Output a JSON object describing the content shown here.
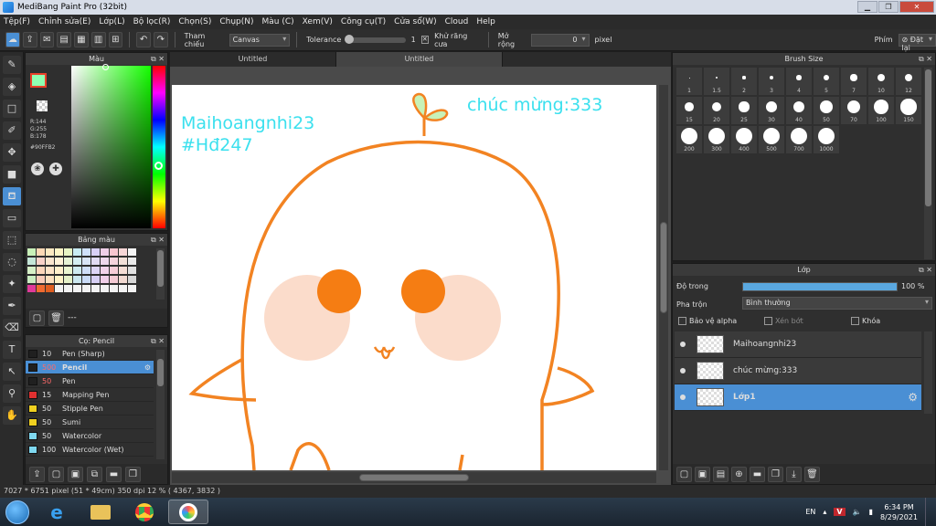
{
  "window": {
    "title": "MediBang Paint Pro (32bit)"
  },
  "menu": [
    "Tệp(F)",
    "Chỉnh sửa(E)",
    "Lớp(L)",
    "Bộ lọc(R)",
    "Chọn(S)",
    "Chụp(N)",
    "Màu (C)",
    "Xem(V)",
    "Công cụ(T)",
    "Cửa sổ(W)",
    "Cloud",
    "Help"
  ],
  "toolbar": {
    "reference_label": "Tham chiếu",
    "reference_value": "Canvas",
    "tolerance_label": "Tolerance",
    "tolerance_value": "1",
    "antialias_label": "Khử răng cưa",
    "expand_label": "Mở rộng",
    "expand_value": "0",
    "expand_unit": "pixel",
    "key_label": "Phím",
    "reset_label": "Đặt lại"
  },
  "color_panel": {
    "title": "Màu",
    "r": "R:144",
    "g": "G:255",
    "b": "B:178",
    "hex": "#90FFB2",
    "primary": "#90FFB2",
    "secondary": "#e8402a"
  },
  "palette_panel": {
    "title": "Bảng màu",
    "footer": "---",
    "colors": [
      "#c8f0b8",
      "#fdd8b5",
      "#fde9c1",
      "#fef5c6",
      "#e7f4c4",
      "#c9ecf3",
      "#cfe0fb",
      "#d8d0f6",
      "#f0cfe8",
      "#f8c6d0",
      "#f6d6d6",
      "#f4f4f4",
      "#c5e6d8",
      "#f9d2c9",
      "#fbe6cf",
      "#fff2d8",
      "#e6f2d5",
      "#d5eef2",
      "#d9e4f6",
      "#e1dbf3",
      "#efd8ec",
      "#f6d4dd",
      "#f2e0d8",
      "#eaeaea",
      "#d6f0c7",
      "#fcd6bb",
      "#fde4c8",
      "#fff0cc",
      "#eaf5d0",
      "#cfeaf0",
      "#d0def8",
      "#ddd5f6",
      "#f3d3ea",
      "#f7cdd8",
      "#f4ddd5",
      "#e0e0e0",
      "#c9ecc0",
      "#f8ccb9",
      "#fce0bf",
      "#fff3c7",
      "#e5f1c8",
      "#cbe7ef",
      "#cadbf7",
      "#d7cff4",
      "#f1cfe9",
      "#f4cad4",
      "#f1d9d1",
      "#d6d6d6",
      "#e03a9a",
      "#f06b30",
      "#e05e20",
      "#f3f3f3",
      "#f3f3f3",
      "#f3f3f3",
      "#f3f3f3",
      "#f3f3f3",
      "#f3f3f3",
      "#f3f3f3",
      "#f3f3f3",
      "#f3f3f3"
    ]
  },
  "brush_panel": {
    "title": "Cọ: Pencil",
    "brushes": [
      {
        "size": "10",
        "name": "Pen (Sharp)",
        "color": "#202020"
      },
      {
        "size": "500",
        "name": "Pencil",
        "color": "#202020",
        "selected": true
      },
      {
        "size": "50",
        "name": "Pen",
        "color": "#202020"
      },
      {
        "size": "15",
        "name": "Mapping Pen",
        "color": "#e03030"
      },
      {
        "size": "50",
        "name": "Stipple Pen",
        "color": "#f0d020"
      },
      {
        "size": "50",
        "name": "Sumi",
        "color": "#f0d020"
      },
      {
        "size": "50",
        "name": "Watercolor",
        "color": "#7fd8f0"
      },
      {
        "size": "100",
        "name": "Watercolor (Wet)",
        "color": "#7fd8f0"
      }
    ]
  },
  "canvas": {
    "tabs": [
      "Untitled",
      "Untitled"
    ],
    "text1": "Maihoangnhi23",
    "text2": "#Hđ247",
    "text3": "chúc mừng:333"
  },
  "brush_size_panel": {
    "title": "Brush Size",
    "sizes": [
      "1",
      "1.5",
      "2",
      "3",
      "4",
      "5",
      "7",
      "10",
      "12",
      "15",
      "20",
      "25",
      "30",
      "40",
      "50",
      "70",
      "100",
      "150",
      "200",
      "300",
      "400",
      "500",
      "700",
      "1000"
    ]
  },
  "layer_panel": {
    "title": "Lớp",
    "opacity_label": "Độ trong",
    "opacity_value": "100 %",
    "opacity_fraction": 1.0,
    "blend_label": "Pha trộn",
    "blend_value": "Bình thường",
    "protect_alpha": "Bảo vệ alpha",
    "clipping": "Xén bớt",
    "lock": "Khóa",
    "layers": [
      {
        "name": "Maihoangnhi23"
      },
      {
        "name": "chúc mừng:333"
      },
      {
        "name": "Lớp1",
        "selected": true
      }
    ]
  },
  "status": {
    "text": "7027 * 6751 pixel  (51 * 49cm)  350 dpi  12 %  ( 4367, 3832 )"
  },
  "taskbar": {
    "lang": "EN",
    "time": "6:34 PM",
    "date": "8/29/2021"
  }
}
